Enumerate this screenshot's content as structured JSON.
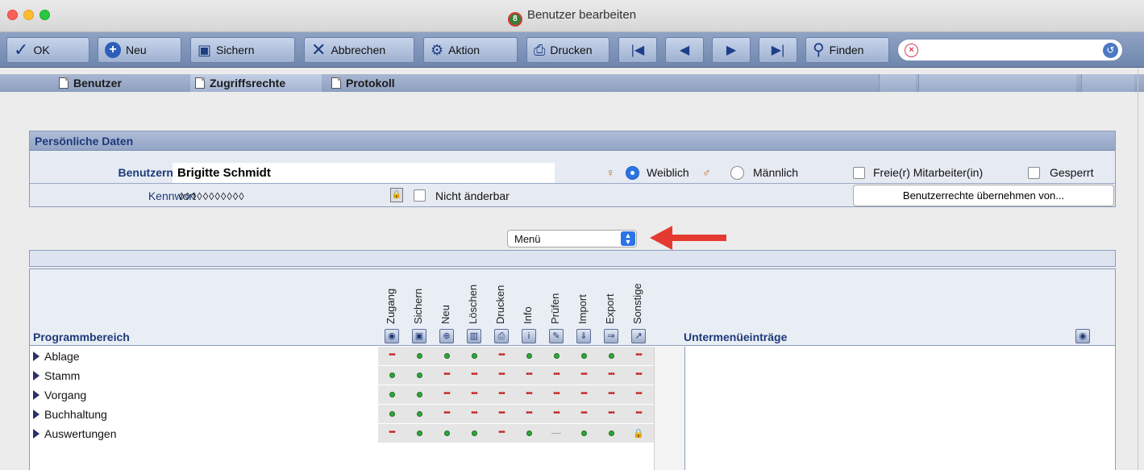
{
  "window": {
    "title": "Benutzer bearbeiten",
    "logo_glyph": "8"
  },
  "toolbar": {
    "ok": "OK",
    "neu": "Neu",
    "sichern": "Sichern",
    "abbrechen": "Abbrechen",
    "aktion": "Aktion",
    "drucken": "Drucken",
    "finden": "Finden",
    "search_value": ""
  },
  "tabs": [
    {
      "label": "Benutzer",
      "active": false
    },
    {
      "label": "Zugriffsrechte",
      "active": true
    },
    {
      "label": "Protokoll",
      "active": false
    }
  ],
  "personal": {
    "section_title": "Persönliche Daten",
    "username_label": "Benutzername",
    "username_value": "Brigitte Schmidt",
    "password_label": "Kennwort",
    "password_value": "◊◊◊◊◊◊◊◊◊◊◊",
    "not_changeable_label": "Nicht änderbar",
    "female_label": "Weiblich",
    "male_label": "Männlich",
    "gender_selected": "Weiblich",
    "freelancer_label": "Freie(r) Mitarbeiter(in)",
    "blocked_label": "Gesperrt",
    "copy_rights_button": "Benutzerrechte übernehmen von..."
  },
  "selector": {
    "value": "Menü"
  },
  "grid": {
    "area_header": "Programmbereich",
    "submenu_header": "Untermenüeinträge",
    "columns": [
      "Zugang",
      "Sichern",
      "Neu",
      "Löschen",
      "Drucken",
      "Info",
      "Prüfen",
      "Import",
      "Export",
      "Sonstige"
    ],
    "rows": [
      {
        "label": "Ablage",
        "cells": [
          "off",
          "on",
          "on",
          "on",
          "off",
          "on",
          "on",
          "on",
          "on",
          "off"
        ]
      },
      {
        "label": "Stamm",
        "cells": [
          "on",
          "on",
          "off",
          "off",
          "off",
          "off",
          "off",
          "off",
          "off",
          "off"
        ]
      },
      {
        "label": "Vorgang",
        "cells": [
          "on",
          "on",
          "off",
          "off",
          "off",
          "off",
          "off",
          "off",
          "off",
          "off"
        ]
      },
      {
        "label": "Buchhaltung",
        "cells": [
          "on",
          "on",
          "off",
          "off",
          "off",
          "off",
          "off",
          "off",
          "off",
          "off"
        ]
      },
      {
        "label": "Auswertungen",
        "cells": [
          "off",
          "on",
          "on",
          "on",
          "off",
          "on",
          "none",
          "on",
          "on",
          "locked"
        ]
      }
    ]
  },
  "colors": {
    "accent": "#2a74e6",
    "on": "#2fa73a",
    "off": "#c42a2a",
    "header_text": "#1e3a7a",
    "arrow": "#e53a2f"
  }
}
